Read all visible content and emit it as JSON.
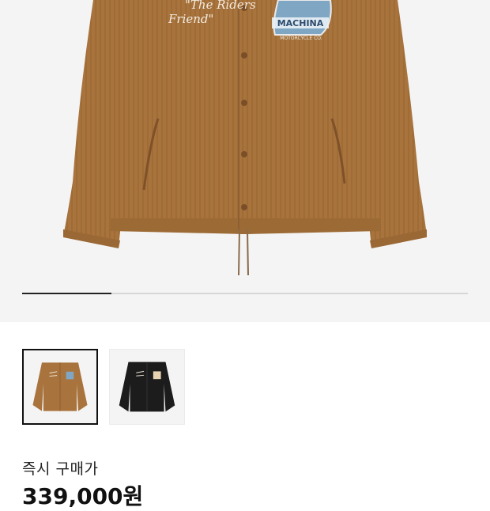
{
  "gallery": {
    "progress_fraction": 0.2,
    "main_image": {
      "icon": "corduroy-coach-jacket-image",
      "embroidery_script": [
        "\"The Riders",
        "Friend\""
      ],
      "patch_text": "MACHINA",
      "patch_subtext": "MOTORCYCLE CO.",
      "colors": {
        "jacket": "#a8733d",
        "jacket_shade": "#8e5f30",
        "patch": "#7fa7c4"
      }
    },
    "thumbnails": [
      {
        "label": "brown",
        "selected": true,
        "color": "#a8733d"
      },
      {
        "label": "black",
        "selected": false,
        "color": "#1c1c1c"
      }
    ]
  },
  "price": {
    "label": "즉시 구매가",
    "value": "339,000원"
  }
}
